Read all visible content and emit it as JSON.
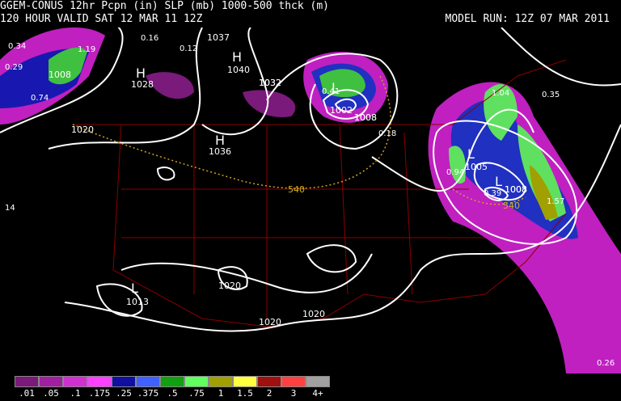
{
  "header": {
    "line1": "GGEM-CONUS 12hr Pcpn (in) SLP (mb) 1000-500 thck (m)",
    "line2": "120 HOUR VALID SAT 12 MAR 11 12Z",
    "model_run": "MODEL RUN: 12Z 07 MAR 2011"
  },
  "pressure_centers": [
    {
      "type": "H",
      "value": "1028"
    },
    {
      "type": "H",
      "value": "1040"
    },
    {
      "type": "H",
      "value": "1036"
    },
    {
      "type": "L",
      "value": "1002"
    },
    {
      "type": "L",
      "value": "1005"
    },
    {
      "type": "L",
      "value": "1008"
    },
    {
      "type": "L",
      "value": "1013"
    }
  ],
  "isobar_labels": [
    "1008",
    "1020",
    "1032",
    "1037",
    "1032",
    "1008",
    "1020",
    "1020",
    "1020",
    "1008",
    "1008"
  ],
  "thickness_labels": [
    "540",
    "540"
  ],
  "precip_amounts": [
    "0.34",
    "0.29",
    "1.19",
    "0.74",
    "0.16",
    "0.12",
    "0.41",
    "0.18",
    "1.04",
    "0.35",
    "0.94",
    "0.39",
    "1.57",
    "14",
    "0.26"
  ],
  "legend": {
    "labels": [
      ".01",
      ".05",
      ".1",
      ".175",
      ".25",
      ".375",
      ".5",
      ".75",
      "1",
      "1.5",
      "2",
      "3",
      "4+"
    ],
    "colors": [
      "#7a1a7a",
      "#a020a0",
      "#d030d0",
      "#ff40ff",
      "#1010a0",
      "#4060ff",
      "#10a010",
      "#60ff60",
      "#a0a000",
      "#ffff40",
      "#a01010",
      "#ff4040",
      "#a0a0a0"
    ]
  },
  "colors": {
    "background": "#000000",
    "isobar": "#ffffff",
    "thickness": "#d0a020",
    "border": "#8b0000"
  }
}
